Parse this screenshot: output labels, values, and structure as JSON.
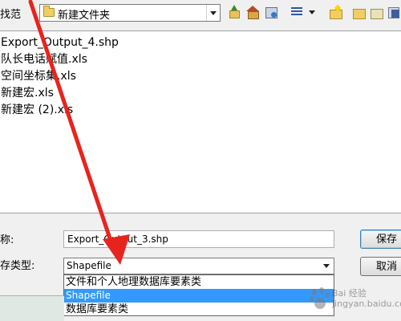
{
  "toolbar": {
    "look_in_label": "找范",
    "path": "新建文件夹"
  },
  "files": [
    "Export_Output_4.shp",
    "队长电话赋值.xls",
    "空间坐标集.xls",
    "新建宏.xls",
    "新建宏 (2).xls"
  ],
  "form": {
    "name_label": "称:",
    "name_value": "Export_Output_3.shp",
    "type_label": "存类型:",
    "type_value": "Shapefile",
    "type_options": [
      "文件和个人地理数据库要素类",
      "Shapefile",
      "数据库要素类"
    ],
    "save_label": "保存",
    "cancel_label": "取消"
  },
  "watermark": {
    "line1": "Bai 经验",
    "line2": "jingyan.baidu.com"
  },
  "colors": {
    "annotation_arrow": "#e8231e",
    "selection": "#3399ff"
  }
}
